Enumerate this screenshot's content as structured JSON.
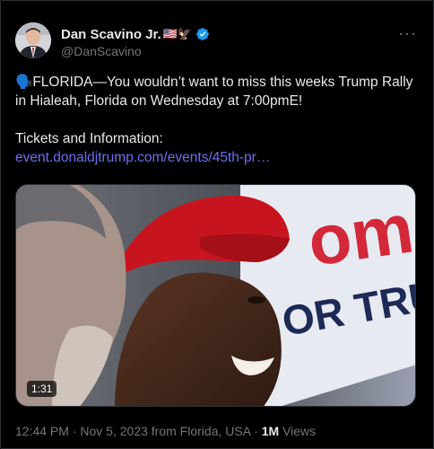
{
  "author": {
    "name": "Dan Scavino Jr.",
    "flag_emojis": "🇺🇸🦅",
    "handle": "@DanScavino",
    "verified_icon": "verified-badge-icon"
  },
  "more_label": "···",
  "tweet": {
    "emoji": "🗣️",
    "line1": "FLORIDA—You wouldn’t want to miss this weeks Trump Rally in Hialeah, Florida on Wednesday at 7:00pmE!",
    "line2": "Tickets and Information:",
    "link": "event.donaldjtrump.com/events/45th-pr…"
  },
  "media": {
    "duration": "1:31",
    "sign_text_1": "ome",
    "sign_text_2": "OR TRU"
  },
  "meta": {
    "time": "12:44 PM",
    "sep1": "·",
    "date_location": "Nov 5, 2023 from Florida, USA",
    "sep2": "·",
    "views_count": "1M",
    "views_label": "Views"
  },
  "colors": {
    "background": "#000000",
    "text": "#e7e9ea",
    "secondary": "#71767b",
    "link": "#6e6ff2",
    "verified": "#1d9bf0"
  }
}
